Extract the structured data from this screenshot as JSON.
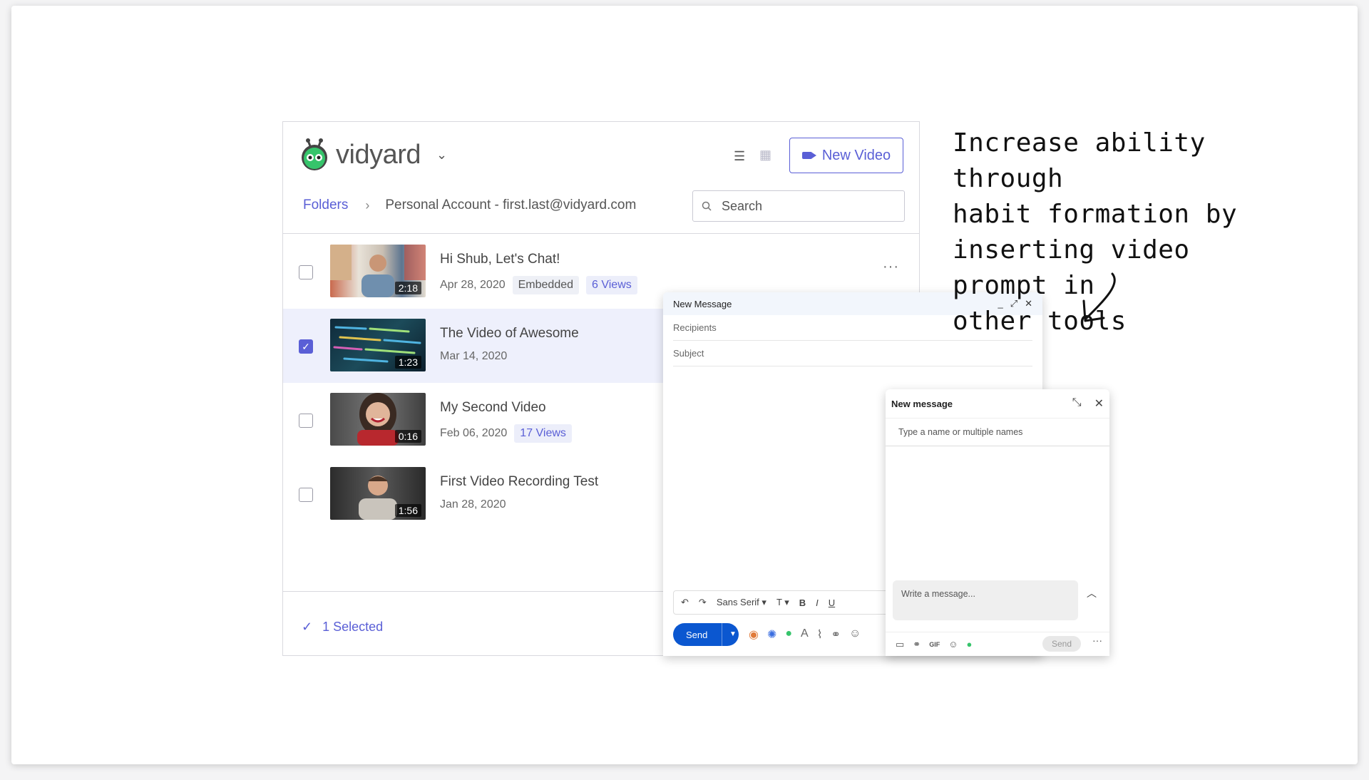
{
  "vidyard": {
    "logo_text": "vidyard",
    "new_video_label": "New Video",
    "breadcrumb": {
      "folders": "Folders",
      "separator": "›",
      "account": "Personal Account - first.last@vidyard.com"
    },
    "search_placeholder": "Search",
    "videos": [
      {
        "title": "Hi Shub, Let's Chat!",
        "date": "Apr 28, 2020",
        "badges": [
          "Embedded"
        ],
        "views": "6 Views",
        "duration": "2:18",
        "checked": false
      },
      {
        "title": "The Video of Awesome",
        "date": "Mar 14, 2020",
        "badges": [],
        "views": "",
        "duration": "1:23",
        "checked": true
      },
      {
        "title": "My Second Video",
        "date": "Feb 06, 2020",
        "badges": [],
        "views": "17 Views",
        "duration": "0:16",
        "checked": false
      },
      {
        "title": "First Video Recording Test",
        "date": "Jan 28, 2020",
        "badges": [],
        "views": "",
        "duration": "1:56",
        "checked": false
      }
    ],
    "selected_count": "1 Selected",
    "accent": "#5a5fd6"
  },
  "gmail": {
    "title": "New Message",
    "recipients": "Recipients",
    "subject": "Subject",
    "font": "Sans Serif",
    "send": "Send"
  },
  "linkedin": {
    "title": "New message",
    "to_placeholder": "Type a name or multiple names",
    "write_placeholder": "Write a message...",
    "send": "Send"
  },
  "note": {
    "lines": [
      "Increase ability through",
      "habit formation by",
      "inserting video prompt in",
      "other tools"
    ]
  }
}
